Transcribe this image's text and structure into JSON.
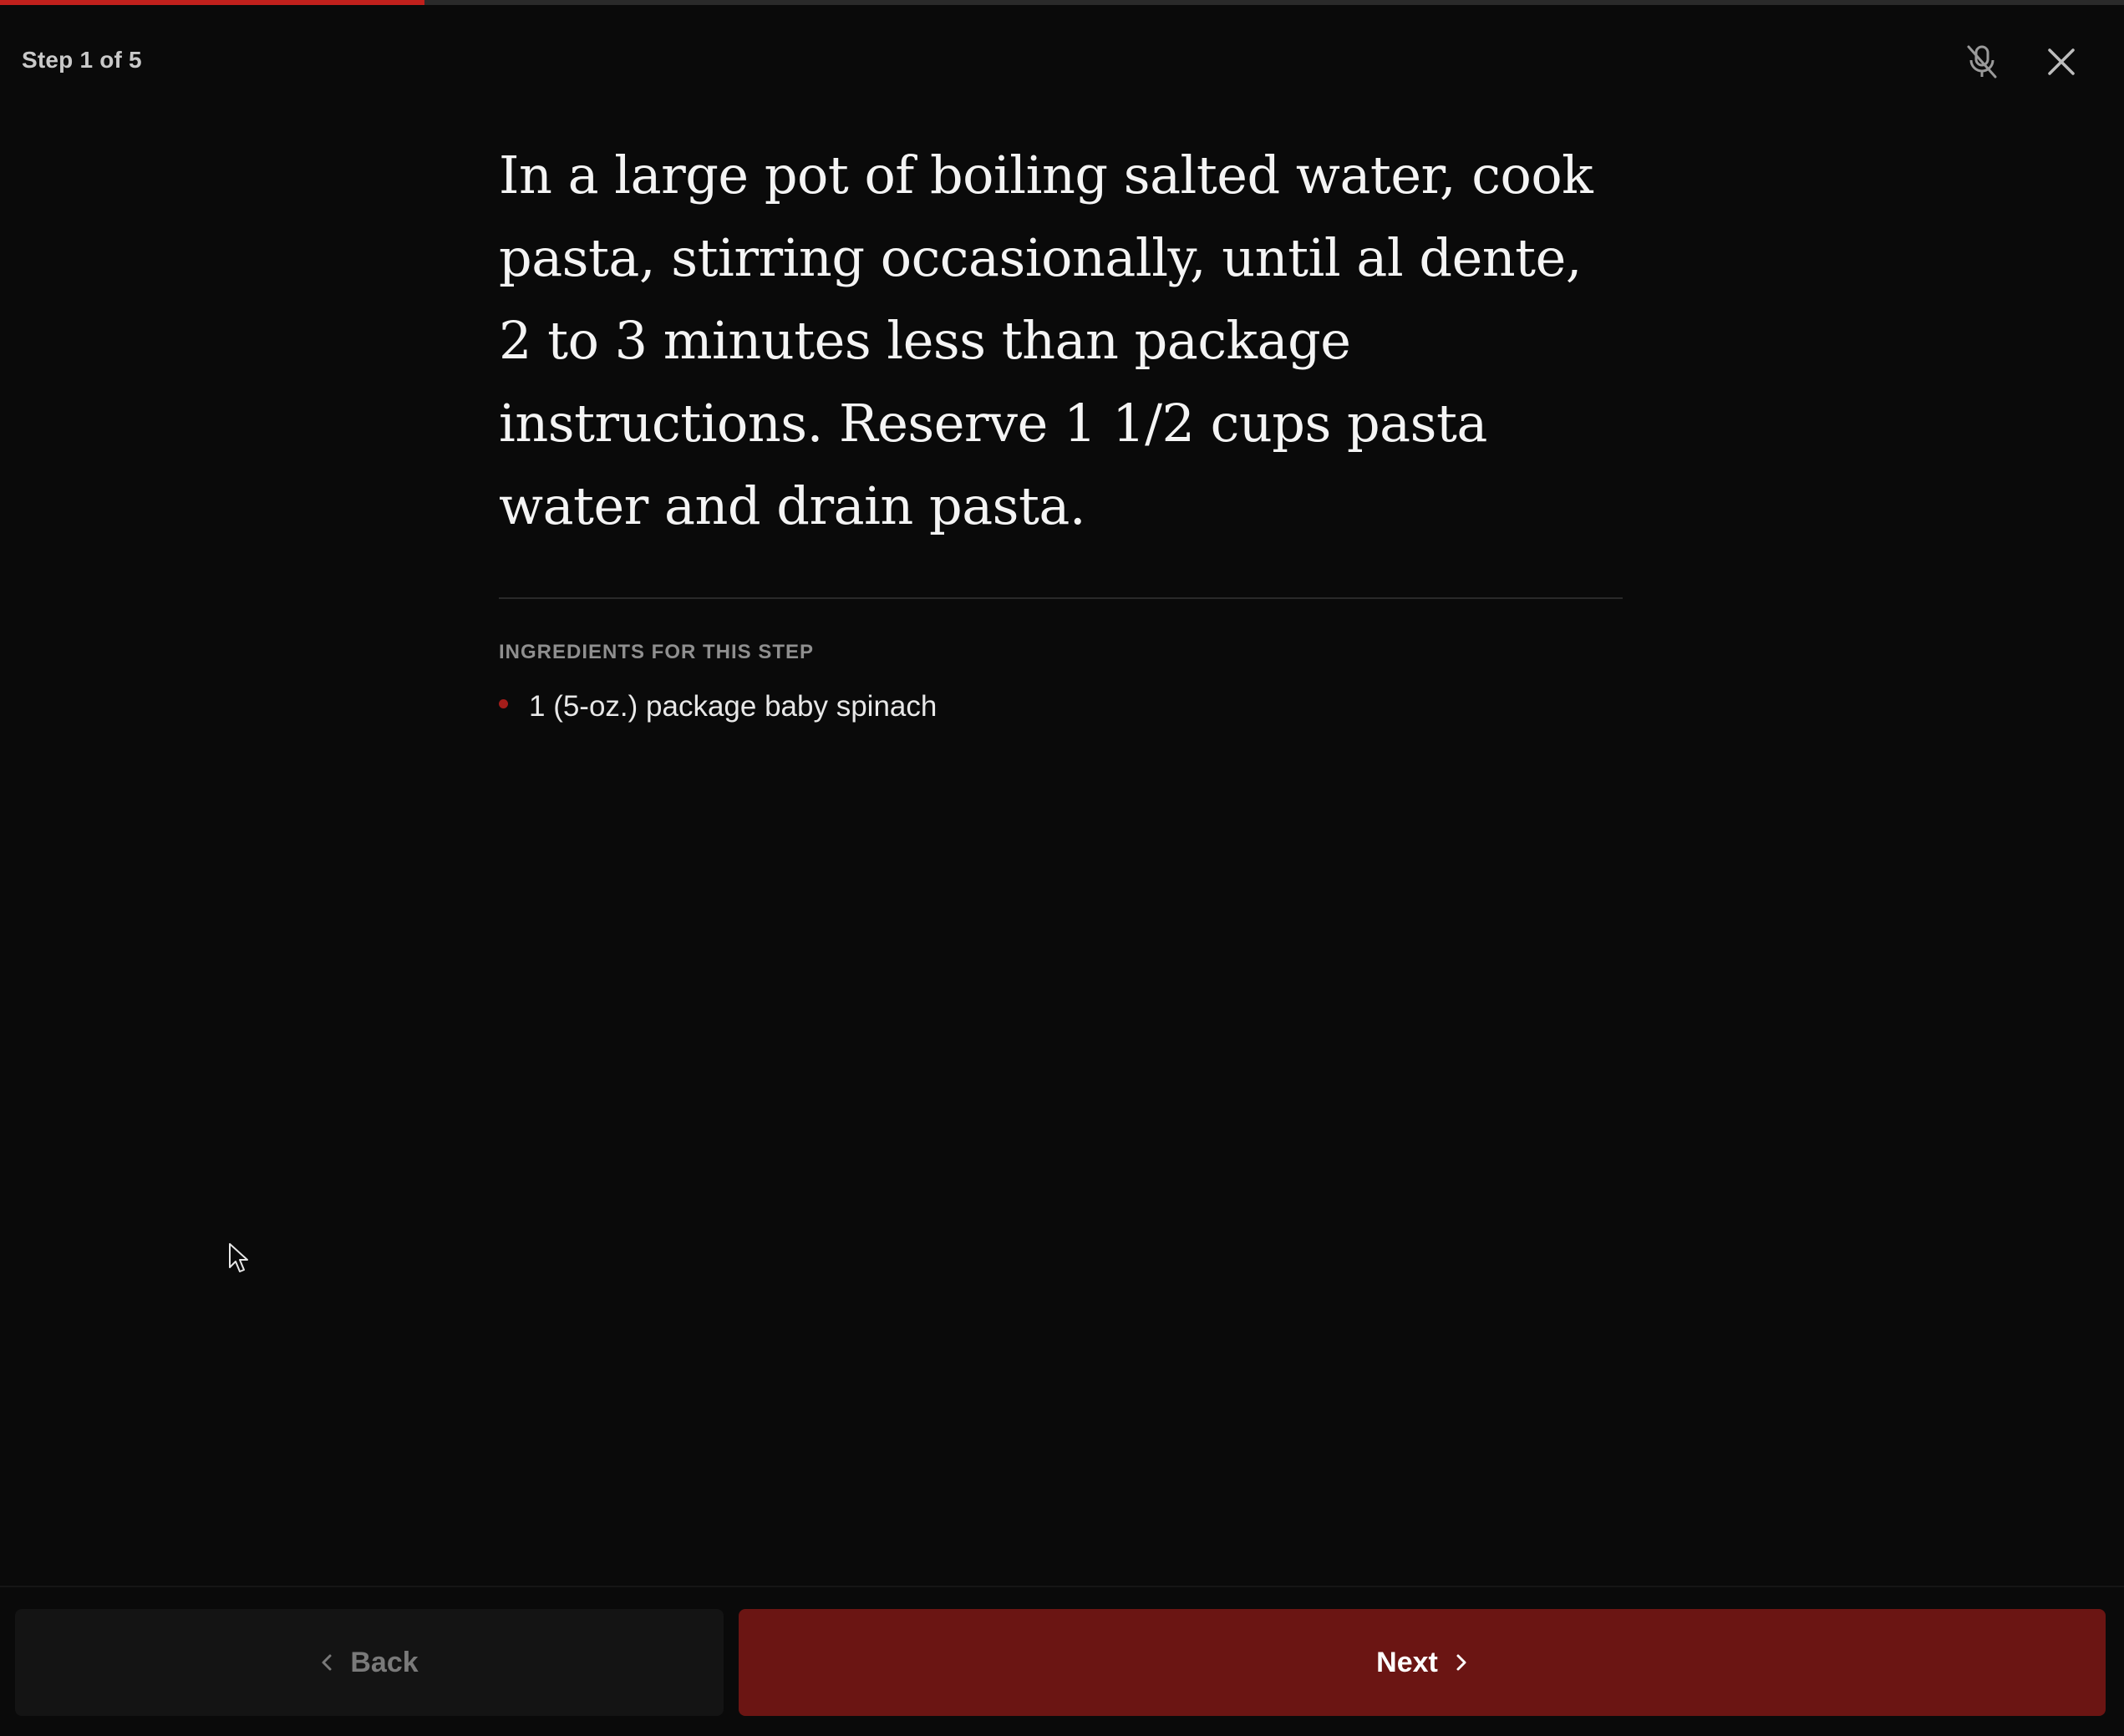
{
  "progress": {
    "current_step": 1,
    "total_steps": 5,
    "fraction": 0.2,
    "color": "#c0201c"
  },
  "header": {
    "step_label": "Step 1 of 5",
    "mic_icon": "mic-off-icon",
    "close_icon": "close-icon"
  },
  "step": {
    "instruction": "In a large pot of boiling salted water, cook pasta, stirring occasionally, until al dente, 2 to 3 minutes less than package instructions. Reserve 1 1/2 cups pasta water and drain pasta."
  },
  "ingredients": {
    "heading": "INGREDIENTS FOR THIS STEP",
    "items": [
      {
        "label": "1 (5-oz.) package baby spinach"
      }
    ]
  },
  "footer": {
    "back_label": "Back",
    "next_label": "Next",
    "next_color": "#6b1513"
  }
}
